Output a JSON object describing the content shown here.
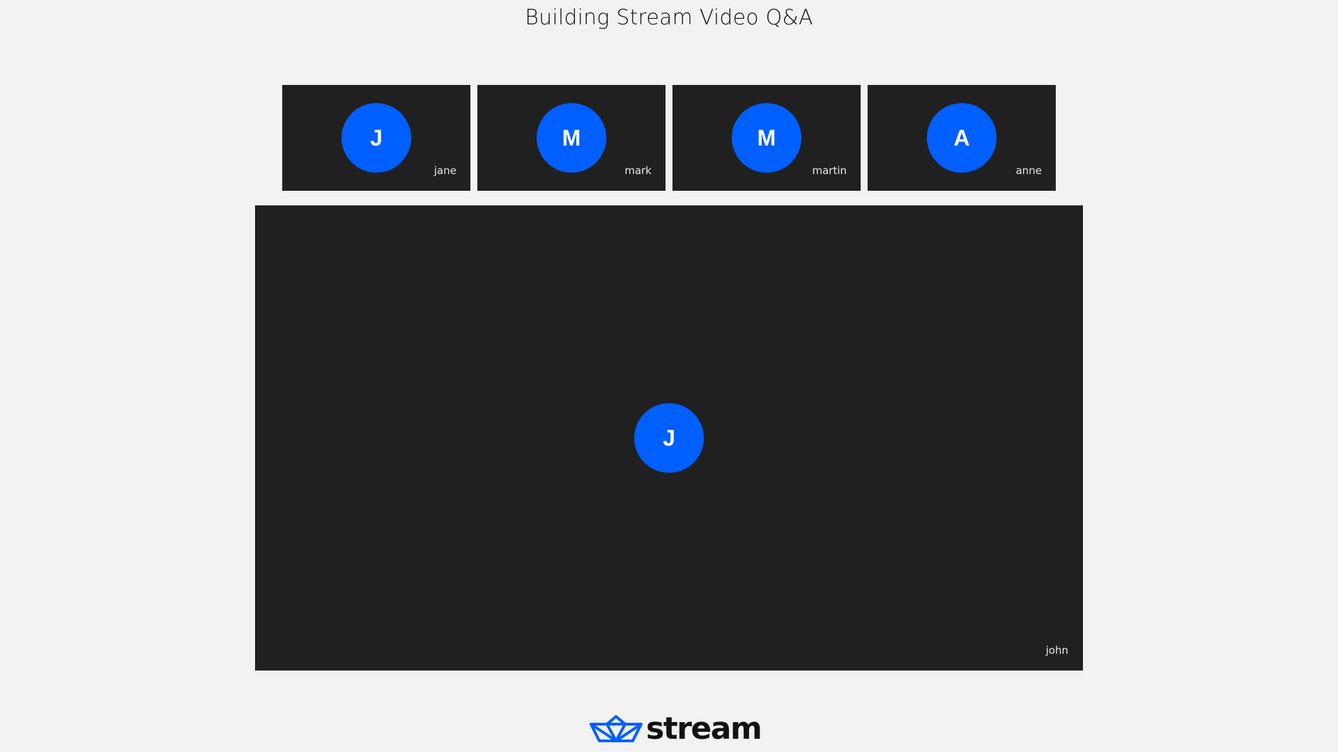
{
  "meeting": {
    "title": "Building Stream Video Q&A"
  },
  "participants": [
    {
      "name": "jane",
      "initial": "J"
    },
    {
      "name": "mark",
      "initial": "M"
    },
    {
      "name": "martin",
      "initial": "M"
    },
    {
      "name": "anne",
      "initial": "A"
    }
  ],
  "dominant_speaker": {
    "name": "john",
    "initial": "J"
  },
  "brand": {
    "logo_text": "stream",
    "logo_icon": "paper-boat-icon"
  },
  "colors": {
    "background": "#f2f2f2",
    "tile_background": "#202020",
    "avatar": "#005fff",
    "brand_blue": "#005fff"
  }
}
